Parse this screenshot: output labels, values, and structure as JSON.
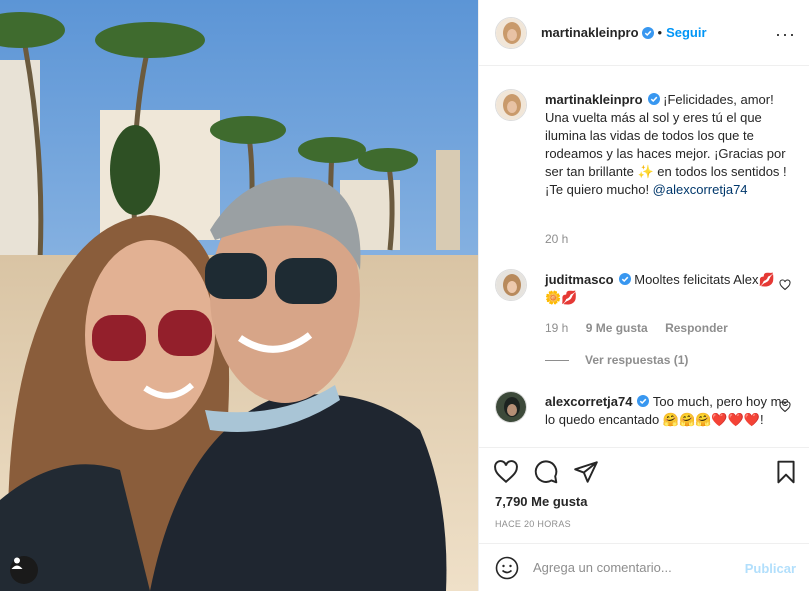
{
  "post": {
    "author": "martinakleinpro",
    "follow_label": "Seguir",
    "separator": "•",
    "more_label": "···",
    "caption": {
      "username": "martinakleinpro",
      "text": "¡Felicidades, amor! Una vuelta más al sol y eres tú el que ilumina las vidas de todos los que te rodeamos y las haces mejor. ¡Gracias por ser tan brillante ✨ en todos los sentidos ! ¡Te quiero mucho! ",
      "mention": "@alexcorretja74",
      "time": "20 h"
    },
    "comments": [
      {
        "username": "juditmasco",
        "text": "Mooltes felicitats Alex💋🌼💋",
        "time": "19 h",
        "likes": "9 Me gusta",
        "reply_label": "Responder",
        "view_replies": "Ver respuestas (1)"
      },
      {
        "username": "alexcorretja74",
        "text": "Too much, pero hoy me lo quedo encantado 🤗🤗🤗❤️❤️❤️!"
      }
    ],
    "likes_count": "7,790 Me gusta",
    "date": "HACE 20 HORAS",
    "comment_placeholder": "Agrega un comentario...",
    "publish_label": "Publicar"
  },
  "icons": {
    "verified": "verified-badge-icon",
    "like": "heart-icon",
    "comment": "comment-icon",
    "share": "paper-plane-icon",
    "save": "bookmark-icon",
    "emoji": "emoji-icon",
    "tag": "user-tag-icon"
  },
  "colors": {
    "accent": "#0095f6",
    "verified": "#3897f0",
    "muted": "#8e8e8e",
    "publish_disabled": "#b2dffc"
  }
}
